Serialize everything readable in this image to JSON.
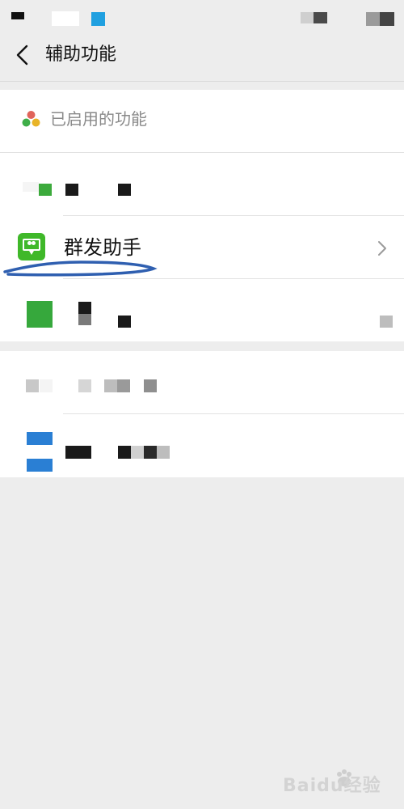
{
  "header": {
    "title": "辅助功能",
    "back_icon": "chevron-left-icon"
  },
  "enabled_section": {
    "title": "已启用的功能",
    "header_icon": "three-dots-icon",
    "header_icon_colors": [
      "#e0645a",
      "#3fae49",
      "#e8b428"
    ],
    "items": [
      {
        "label": "",
        "icon": "redacted-icon"
      },
      {
        "label": "群发助手",
        "icon": "mass-message-icon",
        "icon_color": "#3fb829",
        "chevron": "chevron-right-icon"
      },
      {
        "label": "",
        "icon": "redacted-icon"
      }
    ]
  },
  "disabled_section": {
    "items": [
      {
        "label": "",
        "icon": "redacted-icon"
      },
      {
        "label": "",
        "icon": "redacted-icon"
      }
    ]
  },
  "annotation": {
    "underline_color": "#2f5fb0"
  },
  "watermark": {
    "text": "Baidu经验"
  }
}
